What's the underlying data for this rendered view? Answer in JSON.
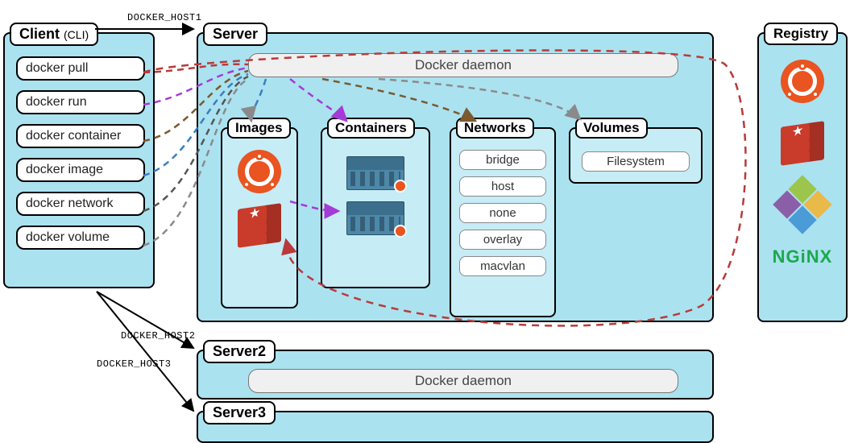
{
  "host_labels": {
    "h1": "DOCKER_HOST1",
    "h2": "DOCKER_HOST2",
    "h3": "DOCKER_HOST3"
  },
  "client": {
    "title": "Client ",
    "subtitle": "(CLI)",
    "commands": [
      "docker pull",
      "docker run",
      "docker container",
      "docker image",
      "docker network",
      "docker volume"
    ]
  },
  "server1": {
    "title": "Server",
    "daemon": "Docker daemon",
    "sections": {
      "images": {
        "title": "Images"
      },
      "containers": {
        "title": "Containers"
      },
      "networks": {
        "title": "Networks",
        "items": [
          "bridge",
          "host",
          "none",
          "overlay",
          "macvlan"
        ]
      },
      "volumes": {
        "title": "Volumes",
        "items": [
          "Filesystem"
        ]
      }
    }
  },
  "server2": {
    "title": "Server2",
    "daemon": "Docker daemon"
  },
  "server3": {
    "title": "Server3"
  },
  "registry": {
    "title": "Registry",
    "nginx_label": "NGiNX"
  }
}
